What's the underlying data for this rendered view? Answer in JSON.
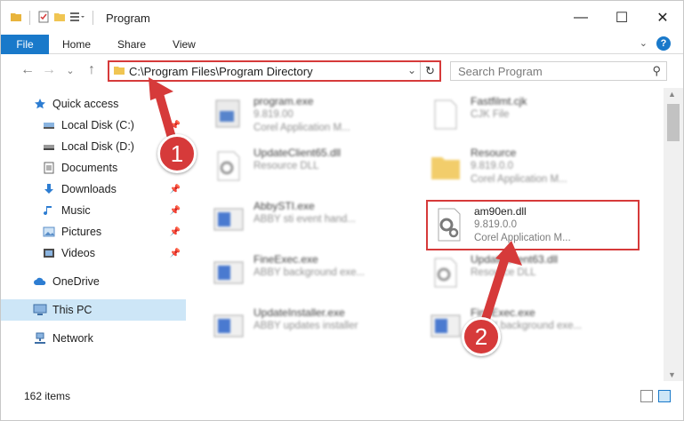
{
  "window": {
    "title": "Program",
    "minimize": "—",
    "maximize": "☐",
    "close": "✕"
  },
  "ribbon": {
    "file": "File",
    "home": "Home",
    "share": "Share",
    "view": "View",
    "help": "?"
  },
  "nav": {
    "back": "←",
    "forward": "→",
    "recent": "⌄",
    "up": "↑",
    "address": "C:\\Program Files\\Program Directory",
    "refresh": "↻",
    "search_placeholder": "Search Program"
  },
  "sidebar": {
    "items": [
      {
        "label": "Quick access"
      },
      {
        "label": "Local Disk (C:)"
      },
      {
        "label": "Local Disk (D:)"
      },
      {
        "label": "Documents"
      },
      {
        "label": "Downloads"
      },
      {
        "label": "Music"
      },
      {
        "label": "Pictures"
      },
      {
        "label": "Videos"
      },
      {
        "label": "OneDrive"
      },
      {
        "label": "This PC"
      },
      {
        "label": "Network"
      }
    ]
  },
  "files": [
    {
      "name": "program.exe",
      "line1": "9.819.00",
      "line2": "Corel Application M..."
    },
    {
      "name": "Fastfilmt.cjk",
      "line1": "CJK File",
      "line2": ""
    },
    {
      "name": "UpdateClient65.dll",
      "line1": "Resource DLL",
      "line2": ""
    },
    {
      "name": "Resource",
      "line1": "9.819.0.0",
      "line2": "Corel Application M..."
    },
    {
      "name": "AbbySTI.exe",
      "line1": "ABBY sti event hand...",
      "line2": ""
    },
    {
      "name": "am90en.dll",
      "line1": "9.819.0.0",
      "line2": "Corel Application M..."
    },
    {
      "name": "FineExec.exe",
      "line1": "ABBY background exe...",
      "line2": ""
    },
    {
      "name": "UpdateClient63.dll",
      "line1": "Resource DLL",
      "line2": ""
    },
    {
      "name": "UpdateInstaller.exe",
      "line1": "ABBY updates installer",
      "line2": ""
    },
    {
      "name": "FineExec.exe",
      "line1": "ABBY background exe...",
      "line2": ""
    }
  ],
  "status": {
    "count": "162 items"
  },
  "annotations": {
    "step1": "1",
    "step2": "2",
    "color": "#d63a3a"
  }
}
